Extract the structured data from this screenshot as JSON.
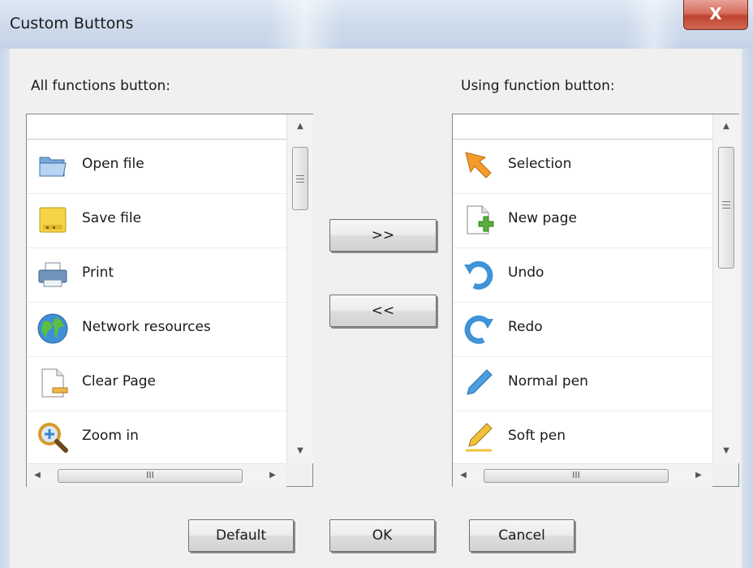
{
  "window": {
    "title": "Custom Buttons",
    "close_glyph": "X"
  },
  "left_panel": {
    "label": "All functions button:",
    "items": [
      {
        "label": "Open file",
        "icon": "folder-icon"
      },
      {
        "label": "Save file",
        "icon": "save-icon"
      },
      {
        "label": "Print",
        "icon": "printer-icon"
      },
      {
        "label": "Network resources",
        "icon": "globe-icon"
      },
      {
        "label": "Clear Page",
        "icon": "clear-page-icon"
      },
      {
        "label": "Zoom in",
        "icon": "zoom-in-icon"
      }
    ]
  },
  "right_panel": {
    "label": "Using function button:",
    "items": [
      {
        "label": "Selection",
        "icon": "cursor-arrow-icon"
      },
      {
        "label": "New page",
        "icon": "new-page-icon"
      },
      {
        "label": "Undo",
        "icon": "undo-icon"
      },
      {
        "label": "Redo",
        "icon": "redo-icon"
      },
      {
        "label": "Normal pen",
        "icon": "pen-icon"
      },
      {
        "label": "Soft pen",
        "icon": "soft-pen-icon"
      }
    ]
  },
  "transfer": {
    "add_label": ">>",
    "remove_label": "<<"
  },
  "footer": {
    "default_label": "Default",
    "ok_label": "OK",
    "cancel_label": "Cancel"
  },
  "scrollbar": {
    "grip_glyph": "III"
  }
}
